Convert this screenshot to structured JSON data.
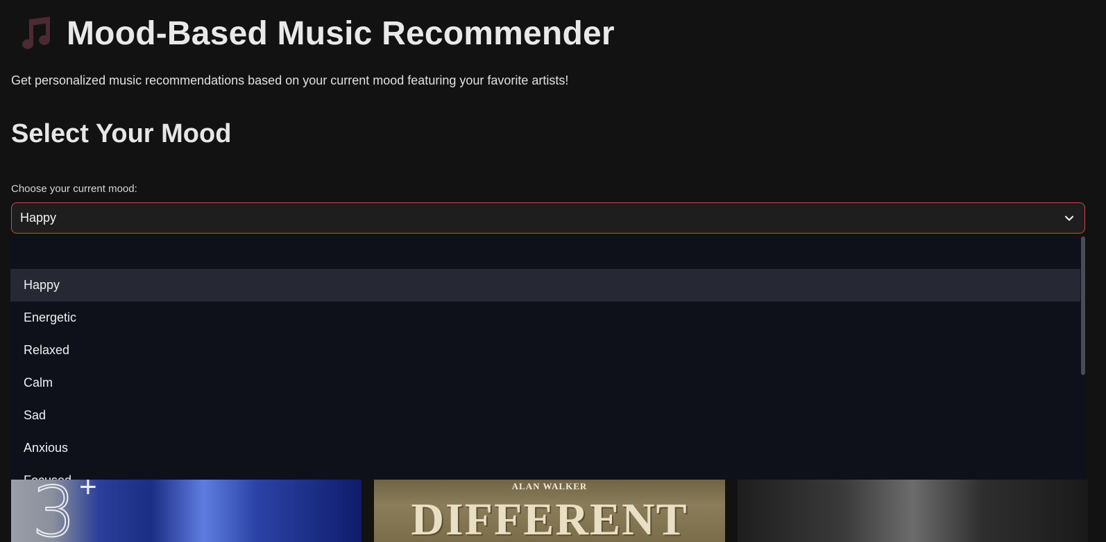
{
  "header": {
    "title": "Mood-Based Music Recommender",
    "icon": "musical-note-icon",
    "subtitle": "Get personalized music recommendations based on your current mood featuring your favorite artists!"
  },
  "mood_section": {
    "title": "Select Your Mood",
    "label": "Choose your current mood:",
    "selected": "Happy",
    "options": [
      "Happy",
      "Energetic",
      "Relaxed",
      "Calm",
      "Sad",
      "Anxious",
      "Focused"
    ]
  },
  "albums": [
    {
      "cover_text": "3",
      "cover_sup": "+"
    },
    {
      "artist": "ALAN WALKER",
      "cover_text": "DIFFERENT"
    },
    {
      "cover_text": ""
    }
  ],
  "colors": {
    "background": "#121212",
    "accent_border": "#d64545",
    "dropdown_bg": "#0e111a",
    "selected_option_bg": "#262834",
    "icon_color": "#4a2a33"
  }
}
